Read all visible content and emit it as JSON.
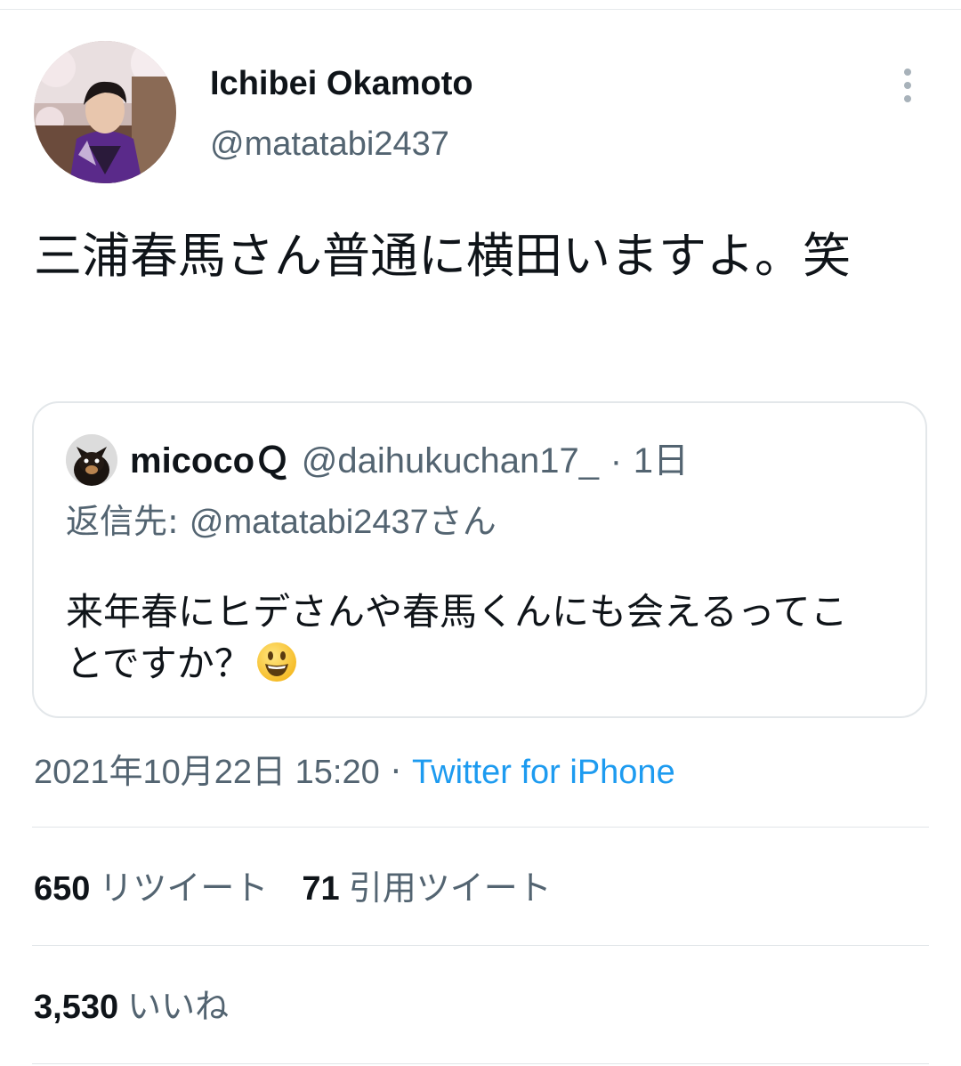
{
  "tweet": {
    "author": {
      "display_name": "Ichibei Okamoto",
      "handle": "@matatabi2437"
    },
    "text": "三浦春馬さん普通に横田いますよ。笑",
    "quoted": {
      "display_name": "micocoＱ",
      "handle": "@daihukuchan17_",
      "separator": "·",
      "time": "1日",
      "reply_label": "返信先: ",
      "reply_handle": "@matatabi2437",
      "reply_suffix": "さん",
      "text": "来年春にヒデさんや春馬くんにも会えるってことですか？",
      "emoji": "smiling-face-emoji"
    },
    "timestamp": "2021年10月22日 15:20",
    "meta_separator": "·",
    "source": "Twitter for iPhone"
  },
  "stats": {
    "retweets": {
      "count": "650",
      "label": "リツイート"
    },
    "quotes": {
      "count": "71",
      "label": "引用ツイート"
    },
    "likes": {
      "count": "3,530",
      "label": "いいね"
    }
  },
  "colors": {
    "text_primary": "#0f1419",
    "text_secondary": "#536471",
    "link": "#1d9bf0",
    "border": "#e1e5e8"
  }
}
